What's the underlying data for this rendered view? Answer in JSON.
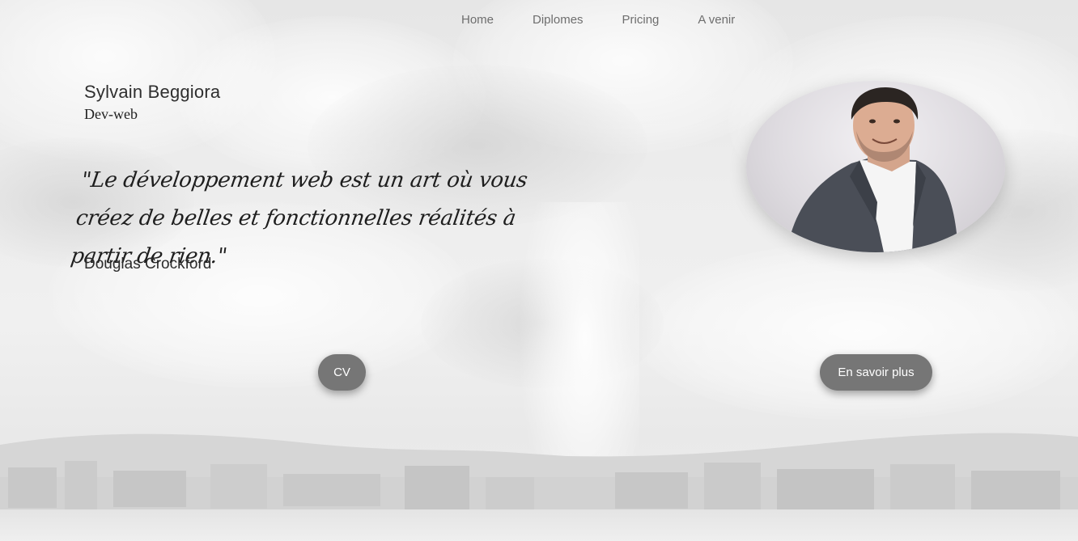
{
  "nav": {
    "items": [
      {
        "label": "Home"
      },
      {
        "label": "Diplomes"
      },
      {
        "label": "Pricing"
      },
      {
        "label": "A venir"
      }
    ]
  },
  "hero": {
    "name": "Sylvain Beggiora",
    "role": "Dev-web",
    "quote": "\"Le développement web est un art où vous créez de belles et fonctionnelles réalités à partir de rien.\"",
    "author": "Douglas Crockford"
  },
  "buttons": {
    "cv_label": "CV",
    "more_label": "En savoir plus"
  },
  "colors": {
    "button_bg": "#767676",
    "button_text": "#ffffff",
    "nav_text": "#6e6e6e",
    "background": "#ececec"
  },
  "icons": {
    "portrait": "profile-photo"
  }
}
